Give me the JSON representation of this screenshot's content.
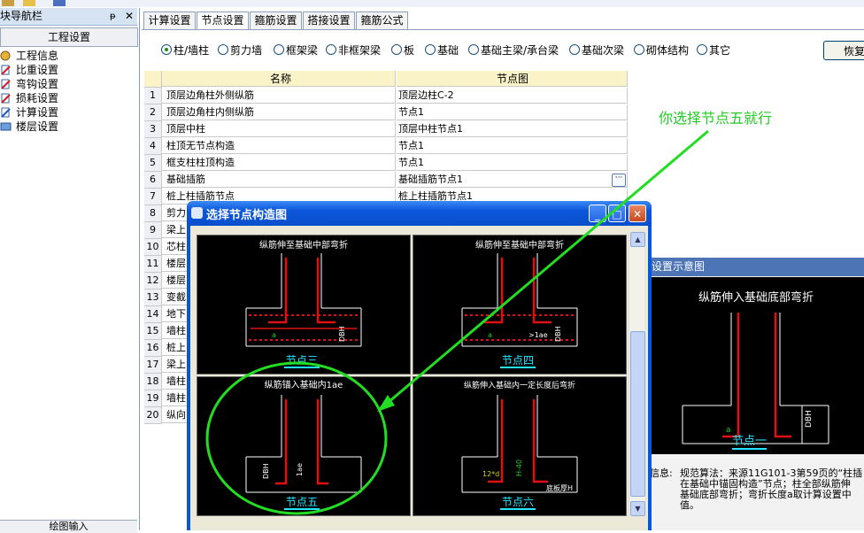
{
  "left_panel": {
    "title": "块导航栏",
    "pin": "ᵽ",
    "close": "✕",
    "header": "工程设置",
    "items": [
      {
        "label": "工程信息",
        "icon": "info-icon"
      },
      {
        "label": "比重设置",
        "icon": "weight-icon"
      },
      {
        "label": "弯钩设置",
        "icon": "hook-icon"
      },
      {
        "label": "损耗设置",
        "icon": "loss-icon"
      },
      {
        "label": "计算设置",
        "icon": "calc-icon"
      },
      {
        "label": "楼层设置",
        "icon": "floor-icon"
      }
    ],
    "bottom": "绘图输入"
  },
  "tabs": [
    "计算设置",
    "节点设置",
    "箍筋设置",
    "搭接设置",
    "箍筋公式"
  ],
  "active_tab": 1,
  "radios": [
    {
      "label": "柱/墙柱",
      "checked": true
    },
    {
      "label": "剪力墙",
      "checked": false
    },
    {
      "label": "框架梁",
      "checked": false
    },
    {
      "label": "非框架梁",
      "checked": false
    },
    {
      "label": "板",
      "checked": false
    },
    {
      "label": "基础",
      "checked": false
    },
    {
      "label": "基础主梁/承台梁",
      "checked": false
    },
    {
      "label": "基础次梁",
      "checked": false
    },
    {
      "label": "砌体结构",
      "checked": false
    },
    {
      "label": "其它",
      "checked": false
    }
  ],
  "restore_button": "恢复",
  "grid": {
    "headers": {
      "name": "名称",
      "node": "节点图"
    },
    "rows": [
      {
        "idx": "1",
        "name": "顶层边角柱外侧纵筋",
        "node": "顶层边柱C-2"
      },
      {
        "idx": "2",
        "name": "顶层边角柱内侧纵筋",
        "node": "节点1"
      },
      {
        "idx": "3",
        "name": "顶层中柱",
        "node": "顶层中柱节点1"
      },
      {
        "idx": "4",
        "name": "柱顶无节点构造",
        "node": "节点1"
      },
      {
        "idx": "5",
        "name": "框支柱柱顶构造",
        "node": "节点1"
      },
      {
        "idx": "6",
        "name": "基础插筋",
        "node": "基础插筋节点1"
      },
      {
        "idx": "7",
        "name": "桩上柱插筋节点",
        "node": "桩上柱插筋节点1"
      },
      {
        "idx": "8",
        "name": "剪力",
        "node": ""
      },
      {
        "idx": "9",
        "name": "梁上",
        "node": ""
      },
      {
        "idx": "10",
        "name": "芯柱",
        "node": ""
      },
      {
        "idx": "11",
        "name": "楼层",
        "node": ""
      },
      {
        "idx": "12",
        "name": "楼层",
        "node": ""
      },
      {
        "idx": "13",
        "name": "变截",
        "node": ""
      },
      {
        "idx": "14",
        "name": "地下",
        "node": ""
      },
      {
        "idx": "15",
        "name": "墙柱",
        "node": ""
      },
      {
        "idx": "16",
        "name": "桩上",
        "node": ""
      },
      {
        "idx": "17",
        "name": "梁上",
        "node": ""
      },
      {
        "idx": "18",
        "name": "墙柱",
        "node": ""
      },
      {
        "idx": "19",
        "name": "墙柱",
        "node": ""
      },
      {
        "idx": "20",
        "name": "纵向",
        "node": ""
      }
    ],
    "more_button": "···"
  },
  "annotation": "你选择节点五就行",
  "dialog": {
    "title": "选择节点构造图",
    "cells": [
      {
        "caption": "纵筋伸至基础中部弯折",
        "label": "节点三",
        "marks": [
          "a",
          "DBH"
        ]
      },
      {
        "caption": "纵筋伸至基础中部弯折",
        "label": "节点四",
        "marks": [
          "a",
          ">1ae",
          "DBH"
        ]
      },
      {
        "caption": "纵筋锚入基础内1ae",
        "label": "节点五",
        "marks": [
          "DBH",
          "1ae"
        ]
      },
      {
        "caption": "纵筋伸入基础内一定长度后弯折",
        "label": "节点六",
        "marks": [
          "12*d",
          "H-40",
          "底板厚H"
        ]
      }
    ]
  },
  "preview": {
    "title": "设置示意图",
    "caption": "纵筋伸入基础底部弯折",
    "marks": [
      "a",
      "DBH"
    ],
    "label": "节点一",
    "info_label": "信息:",
    "info_lines": [
      "规范算法：来源11G101-3第59页的“柱插",
      "在基础中锚固构造”节点；柱全部纵筋伸",
      "基础底部弯折；弯折长度a取计算设置中",
      "值。"
    ]
  },
  "colors": {
    "accent_green": "#22cc22",
    "rebar_red": "#e01010",
    "node_label_cyan": "#22e5ff",
    "grid_header_bg": "#fbf3c8",
    "dialog_title_blue": "#0a56d8"
  }
}
